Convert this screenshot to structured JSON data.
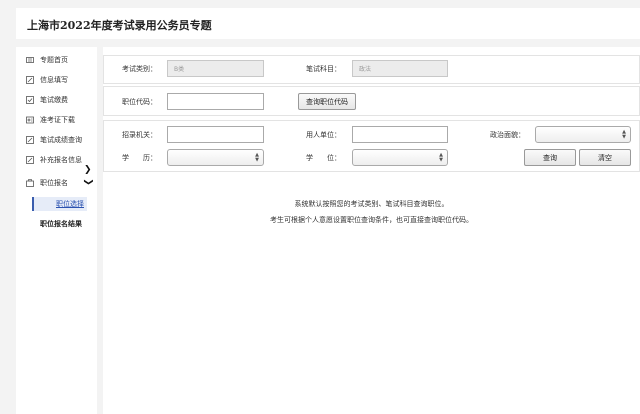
{
  "header": {
    "title": "上海市2022年度考试录用公务员专题"
  },
  "sidebar": {
    "items": [
      {
        "label": "专题首页",
        "icon": "home-icon"
      },
      {
        "label": "信息填写",
        "icon": "edit-icon"
      },
      {
        "label": "笔试缴费",
        "icon": "checkbox-icon"
      },
      {
        "label": "准考证下载",
        "icon": "ticket-icon"
      },
      {
        "label": "笔试成绩查询",
        "icon": "edit-icon"
      },
      {
        "label": "补充报名信息",
        "icon": "edit-icon"
      },
      {
        "label": "职位报名",
        "icon": "briefcase-icon"
      }
    ],
    "subitems": [
      {
        "label": "职位选择",
        "active": true
      },
      {
        "label": "职位报名结果",
        "active": false
      }
    ]
  },
  "form": {
    "exam_type_label": "考试类别：",
    "exam_type_value": "B类",
    "written_subject_label": "笔试科目：",
    "written_subject_value": "政法",
    "position_code_label": "职位代码：",
    "position_code_value": "",
    "query_code_button": "查询职位代码",
    "recruit_org_label": "招录机关：",
    "recruit_org_value": "",
    "employer_label": "用人单位：",
    "employer_value": "",
    "political_label": "政治面貌：",
    "political_value": "",
    "education_label": "学　　历：",
    "education_value": "",
    "degree_label": "学　　位：",
    "degree_value": "",
    "query_button": "查询",
    "clear_button": "清空"
  },
  "messages": {
    "line1": "系统默认按照您的考试类别、笔试科目查询职位。",
    "line2": "考生可根据个人意愿设置职位查询条件，也可直接查询职位代码。"
  }
}
